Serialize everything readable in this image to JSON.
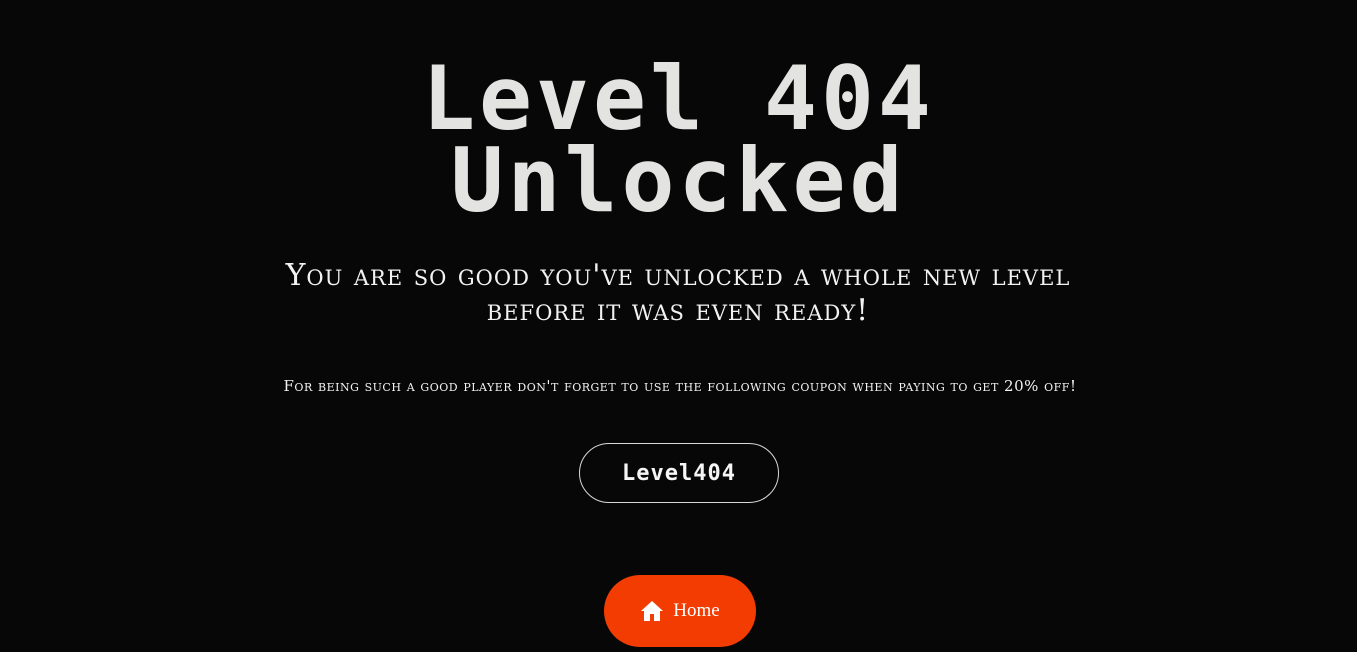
{
  "page": {
    "title_line_1": "Level 404",
    "title_line_2": "Unlocked",
    "subtitle": "You are so good you've unlocked a whole new level before it was even ready!",
    "note": "For being such a good player don't forget to use the following coupon when paying to get 20% off!",
    "coupon_code": "Level404"
  },
  "home_button": {
    "label": "Home",
    "icon": "home-icon",
    "color": "#f23c02"
  },
  "colors": {
    "background": "#070707",
    "title": "#e3e3e1",
    "text": "#f2f2f2"
  }
}
